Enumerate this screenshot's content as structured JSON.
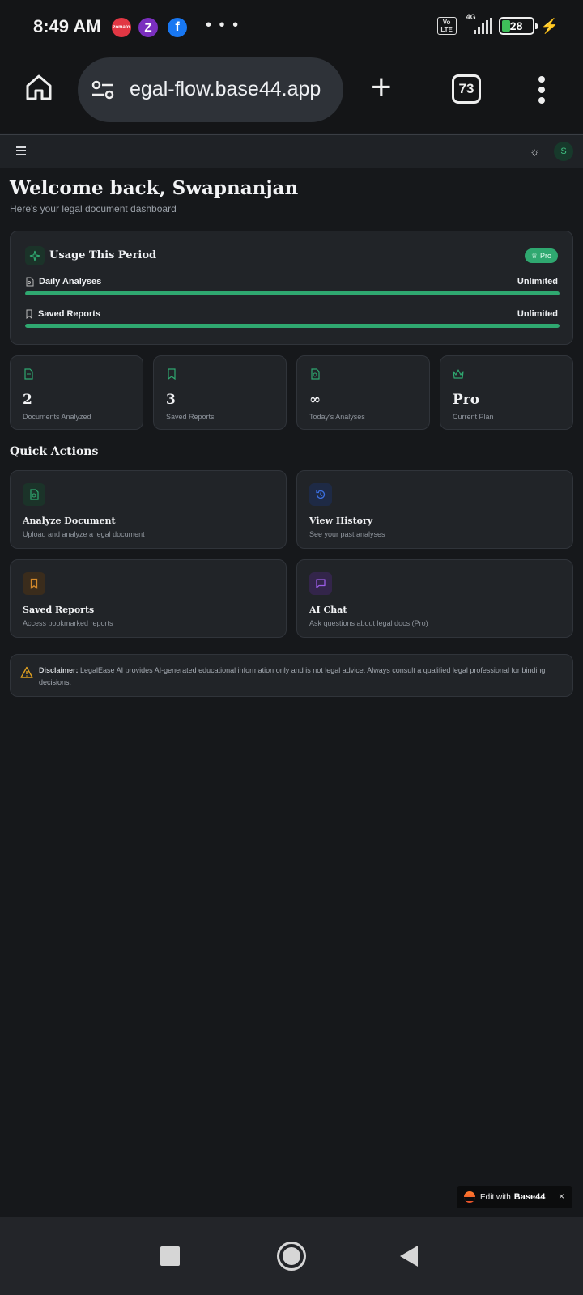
{
  "status_bar": {
    "time": "8:49 AM",
    "apps": [
      {
        "name": "zomato-icon",
        "label": "zomato",
        "color": "#e23744"
      },
      {
        "name": "zepto-icon",
        "label": "Z",
        "color": "#7b2fbf"
      },
      {
        "name": "facebook-icon",
        "label": "f",
        "color": "#1877f2"
      }
    ],
    "more": "• • •",
    "volte": "Vo LTE",
    "network": "4G",
    "battery": "28",
    "battery_level": 0.28,
    "charging_icon": "bolt-icon"
  },
  "browser": {
    "url": "egal-flow.base44.app",
    "tab_count": "73",
    "home_icon": "home-icon",
    "new_tab_icon": "plus-icon",
    "menu_icon": "kebab-menu-icon"
  },
  "header": {
    "avatar_initial": "S",
    "theme_icon": "sun-icon",
    "menu_icon": "hamburger-icon"
  },
  "welcome": {
    "title": "Welcome back, Swapnanjan",
    "subtitle": "Here's your legal document dashboard"
  },
  "usage": {
    "title": "Usage This Period",
    "badge": "Pro",
    "rows": [
      {
        "label": "Daily Analyses",
        "value": "Unlimited",
        "progress": 1.0
      },
      {
        "label": "Saved Reports",
        "value": "Unlimited",
        "progress": 1.0
      }
    ]
  },
  "stats": [
    {
      "value": "2",
      "label": "Documents Analyzed",
      "icon": "document-icon"
    },
    {
      "value": "3",
      "label": "Saved Reports",
      "icon": "bookmark-icon"
    },
    {
      "value": "∞",
      "label": "Today's Analyses",
      "icon": "file-search-icon"
    },
    {
      "value": "Pro",
      "label": "Current Plan",
      "icon": "crown-icon"
    }
  ],
  "quick_actions": {
    "heading": "Quick Actions",
    "items": [
      {
        "title": "Analyze Document",
        "desc": "Upload and analyze a legal document",
        "icon": "file-search-icon",
        "color": "#2fa870"
      },
      {
        "title": "View History",
        "desc": "See your past analyses",
        "icon": "history-icon",
        "color": "#3b6fe0"
      },
      {
        "title": "Saved Reports",
        "desc": "Access bookmarked reports",
        "icon": "bookmark-icon",
        "color": "#d4892a"
      },
      {
        "title": "AI Chat",
        "desc": "Ask questions about legal docs (Pro)",
        "icon": "chat-icon",
        "color": "#9b5de5"
      }
    ]
  },
  "disclaimer": {
    "label": "Disclaimer:",
    "text": " LegalEase AI provides AI-generated educational information only and is not legal advice. Always consult a qualified legal professional for binding decisions."
  },
  "edit_banner": {
    "text": "Edit with",
    "brand": "Base44",
    "close": "×"
  },
  "colors": {
    "accent": "#2fa870",
    "background": "#16181b",
    "card": "#212428"
  }
}
